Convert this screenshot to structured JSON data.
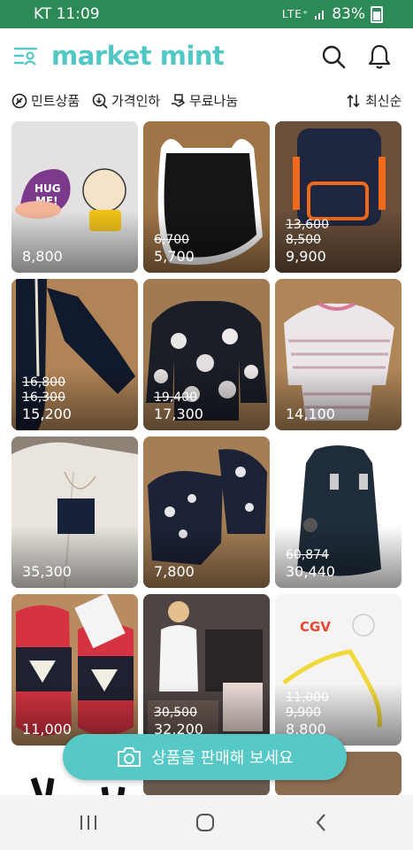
{
  "status": {
    "carrier": "KT 11:09",
    "indicators": "LTE⁺",
    "battery": "83%"
  },
  "app": {
    "logo": "market mint"
  },
  "filters": [
    {
      "label": "민트상품",
      "icon": "leaf-icon"
    },
    {
      "label": "가격인하",
      "icon": "price-drop-icon"
    },
    {
      "label": "무료나눔",
      "icon": "giving-hand-icon"
    }
  ],
  "sort": {
    "label": "최신순",
    "icon": "sort-arrows-icon"
  },
  "products": [
    {
      "old": [],
      "price": "8,800"
    },
    {
      "old": [
        "6,700"
      ],
      "price": "5,700"
    },
    {
      "old": [
        "13,600",
        "8,500"
      ],
      "price": "9,900"
    },
    {
      "old": [
        "16,800",
        "16,300"
      ],
      "price": "15,200"
    },
    {
      "old": [
        "19,400"
      ],
      "price": "17,300"
    },
    {
      "old": [],
      "price": "14,100"
    },
    {
      "old": [],
      "price": "35,300"
    },
    {
      "old": [],
      "price": "7,800"
    },
    {
      "old": [
        "60,874"
      ],
      "price": "30,440"
    },
    {
      "old": [],
      "price": "11,000"
    },
    {
      "old": [
        "30,500"
      ],
      "price": "32,200"
    },
    {
      "old": [
        "11,000",
        "9,900"
      ],
      "price": "8,800"
    }
  ],
  "sell_button": {
    "label": "상품을 판매해 보세요"
  },
  "colors": {
    "brand": "#52c8c6",
    "status_bar": "#2c8a57"
  }
}
